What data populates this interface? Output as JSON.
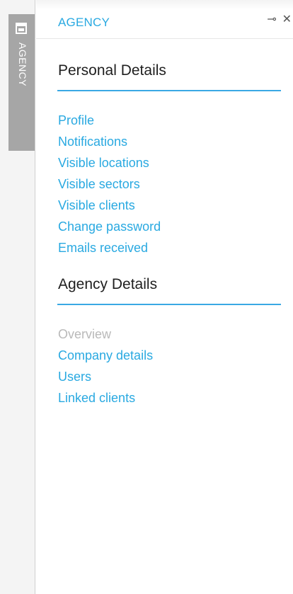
{
  "side_tab": {
    "label": "AGENCY",
    "icon": "panel-icon"
  },
  "header": {
    "title": "AGENCY",
    "pin_glyph": "⊸",
    "close_glyph": "✕"
  },
  "sections": [
    {
      "title": "Personal Details",
      "items": [
        {
          "label": "Profile"
        },
        {
          "label": "Notifications"
        },
        {
          "label": "Visible locations"
        },
        {
          "label": "Visible sectors"
        },
        {
          "label": "Visible clients"
        },
        {
          "label": "Change password"
        },
        {
          "label": "Emails received"
        }
      ]
    },
    {
      "title": "Agency Details",
      "items": [
        {
          "label": "Overview"
        },
        {
          "label": "Company details"
        },
        {
          "label": "Users"
        },
        {
          "label": "Linked clients"
        }
      ]
    }
  ],
  "colors": {
    "accent": "#29a9e1",
    "rule": "#3aa8e4",
    "disabled": "#b9b9b9",
    "side_tab": "#a6a6a6"
  }
}
